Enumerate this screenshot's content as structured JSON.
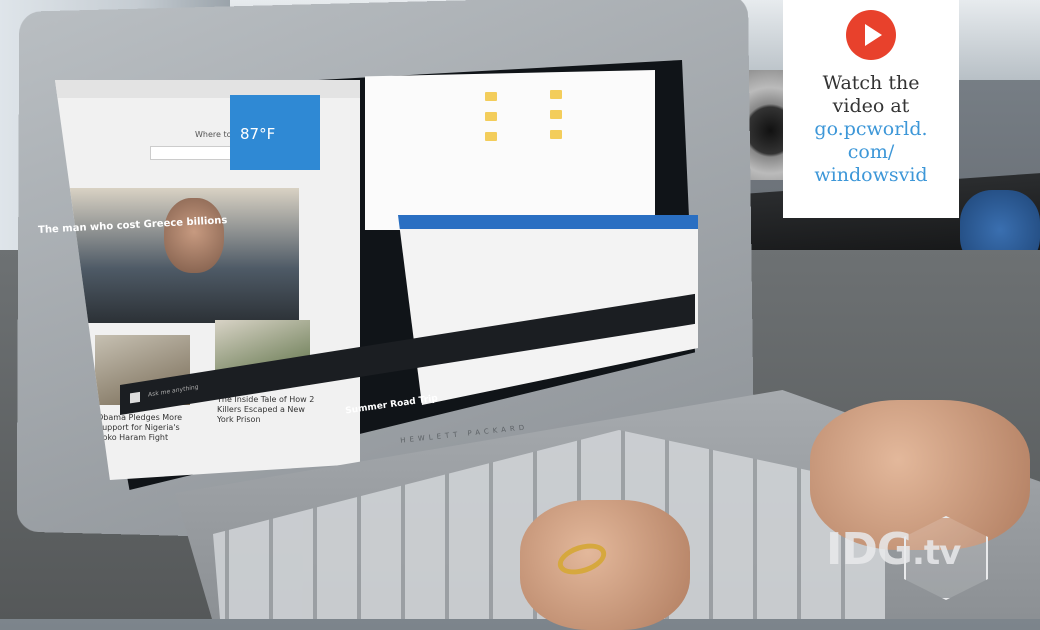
{
  "overlay": {
    "line1": "Watch the",
    "line2": "video at",
    "link1": "go.pcworld.",
    "link2": "com/",
    "link3": "windowsvid",
    "play_color": "#e8412c",
    "link_color": "#3d97d8"
  },
  "logo": {
    "brand": "IDG",
    "suffix": ".tv"
  },
  "screen": {
    "edge_heading": "Where to next?",
    "hero_caption": "The man who cost Greece billions",
    "weather_temp": "87°F",
    "story1": [
      "Obama Pledges More",
      "Support for Nigeria's",
      "Boko Haram Fight"
    ],
    "story2": [
      "The Inside Tale of How 2",
      "Killers Escaped a New",
      "York Prison"
    ],
    "story3": "Summer Road Trip",
    "taskbar_search": "Ask me anything",
    "laptop_brand": "HEWLETT PACKARD"
  }
}
